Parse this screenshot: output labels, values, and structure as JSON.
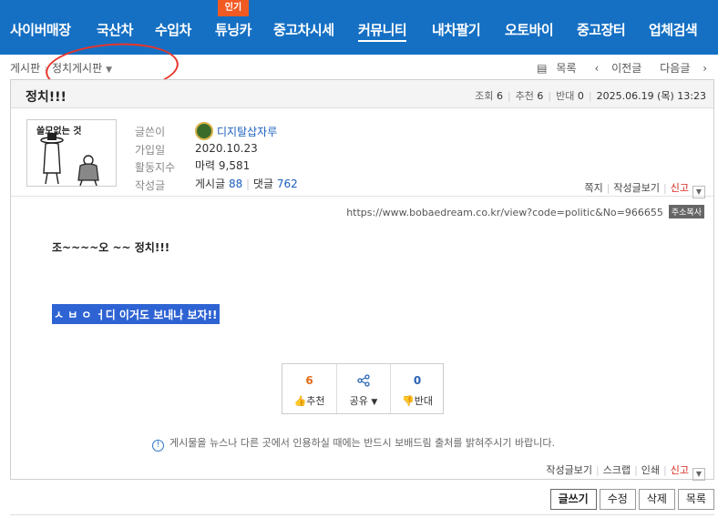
{
  "nav": {
    "hot_badge": "인기",
    "items": [
      "사이버매장",
      "국산차",
      "수입차",
      "튜닝카",
      "중고차시세",
      "커뮤니티",
      "내차팔기",
      "오토바이",
      "중고장터",
      "업체검색"
    ]
  },
  "breadcrumb": {
    "root": "게시판",
    "current": "정치게시판"
  },
  "pager": {
    "list": "목록",
    "prev": "이전글",
    "next": "다음글"
  },
  "post": {
    "title": "정치!!!",
    "meta": {
      "views_label": "조회",
      "views": "6",
      "recommend_label": "추천",
      "recommend": "6",
      "oppose_label": "반대",
      "oppose": "0",
      "date": "2025.06.19 (목) 13:23"
    },
    "url": "https://www.bobaedream.co.kr/view?code=politic&No=966655",
    "copy_label": "주소복사",
    "body_line1": "조~~~~오 ~~ 정치!!!",
    "body_line2": "ㅅ ㅂ ㅇ ㅓ디 이거도 보내나 보자!!"
  },
  "author": {
    "avatar_caption": "쓸모없는 것",
    "labels": {
      "nickname": "글쓴이",
      "joined": "가입일",
      "activity": "활동지수",
      "writings": "작성글"
    },
    "nickname": "디지탈삽자루",
    "joined": "2020.10.23",
    "activity": "마력 9,581",
    "posts_label": "게시글",
    "posts": "88",
    "comments_label": "댓글",
    "comments": "762",
    "links": {
      "note": "쪽지",
      "view_posts": "작성글보기",
      "report": "신고"
    }
  },
  "vote": {
    "recommend_count": "6",
    "recommend_label": "추천",
    "share_label": "공유",
    "oppose_count": "0",
    "oppose_label": "반대"
  },
  "notice": "게시물을 뉴스나 다른 곳에서 인용하실 때에는 반드시 보배드림 출처를 밝혀주시기 바랍니다.",
  "bottom_links": {
    "view_posts": "작성글보기",
    "scrap": "스크랩",
    "print": "인쇄",
    "report": "신고"
  },
  "actions": {
    "write": "글쓰기",
    "edit": "수정",
    "delete": "삭제",
    "list": "목록"
  },
  "colors": {
    "nav_bg": "#1570c4",
    "hot_badge": "#f25a24",
    "highlight": "#2e63d3",
    "annotation_circle": "#e8352a"
  }
}
